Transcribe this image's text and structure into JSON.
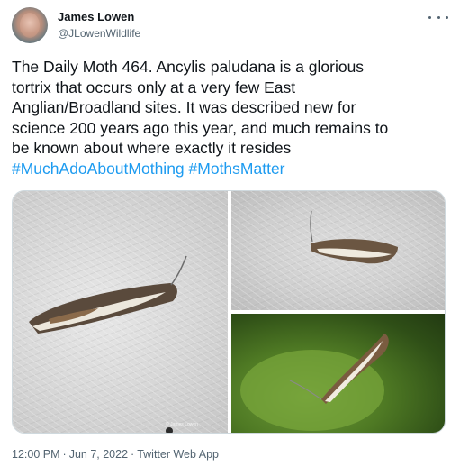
{
  "author": {
    "name": "James Lowen",
    "handle": "@JLowenWildlife"
  },
  "tweet": {
    "lines": [
      "The Daily Moth 464. Ancylis paludana is a glorious",
      "tortrix that occurs only at a very few East",
      "Anglian/Broadland sites. It was described new for",
      "science 200 years ago this year, and much remains to",
      "be known about where exactly it resides"
    ],
    "hashtags": [
      "#MuchAdoAboutMothing",
      "#MothsMatter"
    ]
  },
  "media": {
    "watermark": "© James Lowen"
  },
  "meta": {
    "time": "12:00 PM",
    "date": "Jun 7, 2022",
    "source": "Twitter Web App",
    "separator": "·"
  },
  "colors": {
    "text": "#0f1419",
    "secondary": "#536471",
    "link": "#1d9bf0",
    "border": "#cfd9de"
  }
}
